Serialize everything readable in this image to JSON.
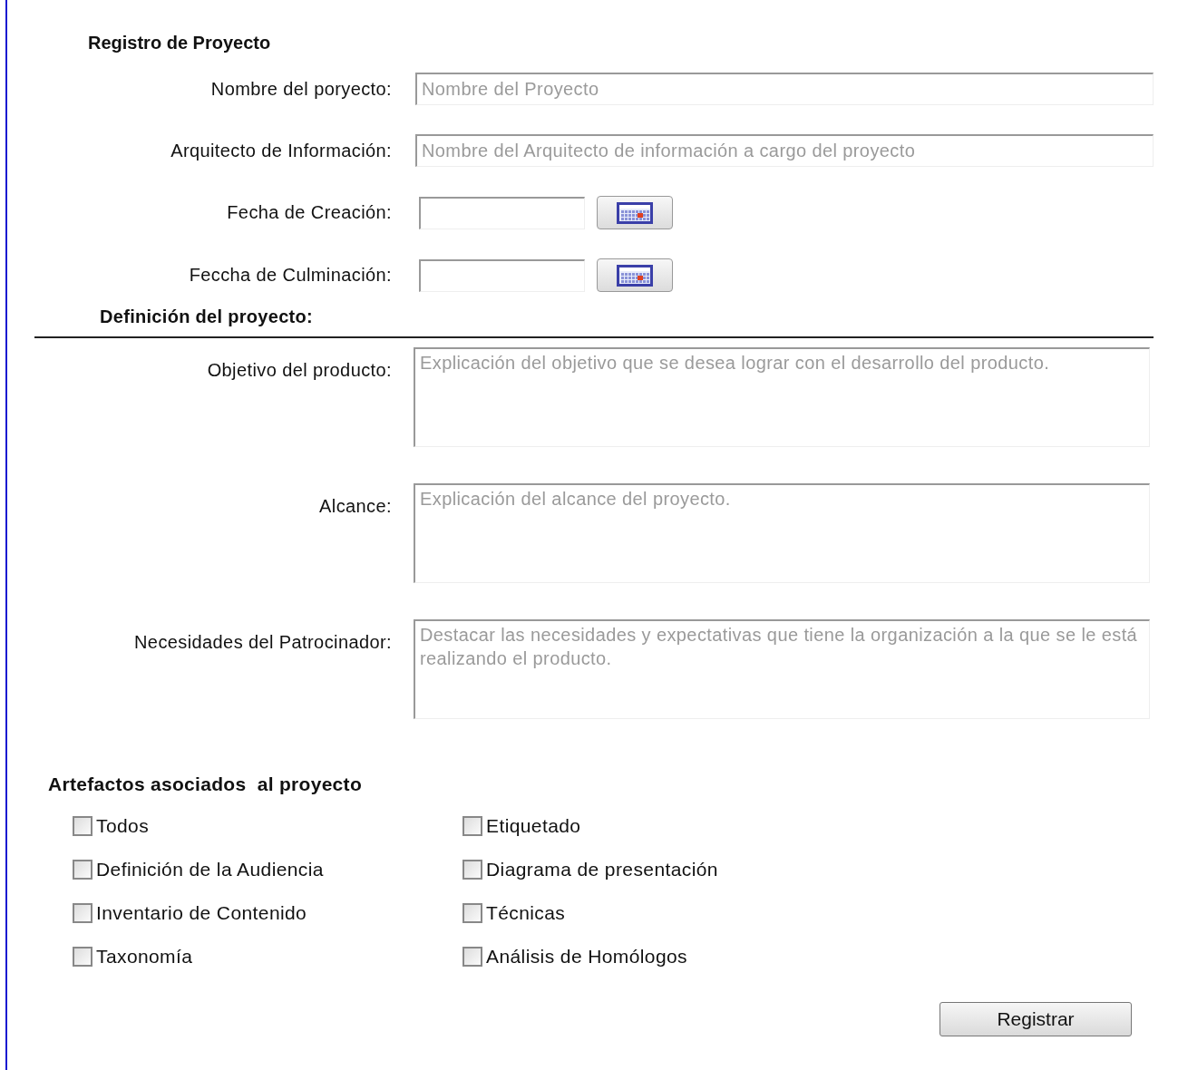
{
  "title": "Registro de Proyecto",
  "fields": [
    {
      "kind": "text",
      "label": "Nombre del poryecto:",
      "placeholder": "Nombre del Proyecto"
    },
    {
      "kind": "text",
      "label": "Arquitecto de Información:",
      "placeholder": "Nombre del Arquitecto de información a cargo del proyecto"
    },
    {
      "kind": "date",
      "label": "Fecha de Creación:"
    },
    {
      "kind": "date",
      "label": "Feccha de Culminación:"
    }
  ],
  "definition": {
    "heading": "Definición del proyecto:",
    "fields": [
      {
        "kind": "textarea",
        "label": "Objetivo del producto:",
        "placeholder": "Explicación del objetivo que se desea lograr con el desarrollo del producto."
      },
      {
        "kind": "textarea",
        "label": "Alcance:",
        "placeholder": "Explicación del alcance del proyecto."
      },
      {
        "kind": "textarea",
        "label": "Necesidades del Patrocinador:",
        "placeholder": "Destacar las necesidades y expectativas que tiene la organización a la que se le está realizando el producto."
      }
    ]
  },
  "artifacts": {
    "heading": "Artefactos asociados  al proyecto",
    "items": [
      {
        "label": "Todos",
        "checked": false
      },
      {
        "label": "Etiquetado",
        "checked": false
      },
      {
        "label": "Definición de la Audiencia",
        "checked": false
      },
      {
        "label": "Diagrama de presentación",
        "checked": false
      },
      {
        "label": "Inventario de Contenido",
        "checked": false
      },
      {
        "label": "Técnicas",
        "checked": false
      },
      {
        "label": "Taxonomía",
        "checked": false
      },
      {
        "label": "Análisis de Homólogos",
        "checked": false
      }
    ]
  },
  "submit": "Registrar"
}
